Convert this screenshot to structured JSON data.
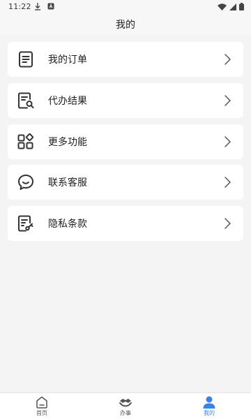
{
  "status_bar": {
    "time": "11:22",
    "left_icons": [
      "download-icon",
      "app-notification-icon"
    ],
    "right_icons": [
      "wifi-icon",
      "signal-icon",
      "battery-icon"
    ]
  },
  "header": {
    "title": "我的"
  },
  "menu": {
    "items": [
      {
        "label": "我的订单",
        "icon": "order-list-icon"
      },
      {
        "label": "代办结果",
        "icon": "document-search-icon"
      },
      {
        "label": "更多功能",
        "icon": "more-functions-icon"
      },
      {
        "label": "联系客服",
        "icon": "chat-smile-icon"
      },
      {
        "label": "隐私条款",
        "icon": "privacy-document-icon"
      }
    ]
  },
  "bottom_nav": {
    "items": [
      {
        "label": "首页",
        "icon": "home-icon",
        "active": false
      },
      {
        "label": "办事",
        "icon": "handshake-icon",
        "active": false
      },
      {
        "label": "我的",
        "icon": "user-icon",
        "active": true
      }
    ],
    "active_color": "#3b82e6",
    "inactive_color": "#555555"
  }
}
